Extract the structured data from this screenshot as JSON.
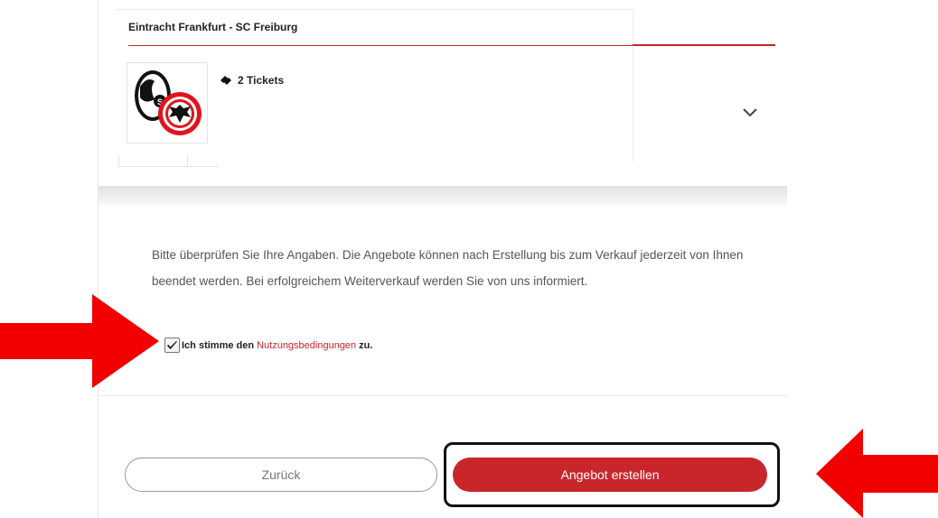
{
  "event": {
    "title": "Eintracht Frankfurt - SC Freiburg",
    "tickets_label": "2 Tickets"
  },
  "icons": {
    "ticket": "ticket-icon",
    "chevron": "chevron-down-icon",
    "check": "check-icon"
  },
  "info": {
    "text": "Bitte überprüfen Sie Ihre Angaben. Die Angebote können nach Erstellung bis zum Verkauf jederzeit von Ihnen beendet werden. Bei erfolgreichem Weiterverkauf werden Sie von uns informiert."
  },
  "terms": {
    "checked": true,
    "prefix": "Ich stimme den",
    "link": "Nutzungsbedingungen",
    "suffix": "zu."
  },
  "buttons": {
    "back": "Zurück",
    "create": "Angebot erstellen"
  },
  "colors": {
    "accent": "#c9262b",
    "annotation_arrow": "#f20000",
    "highlight_box": "#111111"
  }
}
